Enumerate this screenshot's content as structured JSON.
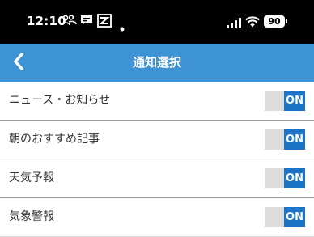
{
  "status_bar": {
    "time": "12:10",
    "battery": "90",
    "icons": [
      "people-icon",
      "message-icon",
      "app-icon",
      "dot-icon",
      "signal-icon",
      "wifi-icon",
      "battery-icon"
    ]
  },
  "nav": {
    "title": "通知選択",
    "back_icon": "chevron-left-icon",
    "background": "#3d93d3"
  },
  "settings": {
    "items": [
      {
        "label": "ニュース・お知らせ",
        "toggle": "ON",
        "enabled": true
      },
      {
        "label": "朝のおすすめ記事",
        "toggle": "ON",
        "enabled": true
      },
      {
        "label": "天気予報",
        "toggle": "ON",
        "enabled": true
      },
      {
        "label": "気象警報",
        "toggle": "ON",
        "enabled": true
      }
    ]
  },
  "colors": {
    "toggle_on": "#1b74c6",
    "toggle_track": "#dcdcdc"
  }
}
